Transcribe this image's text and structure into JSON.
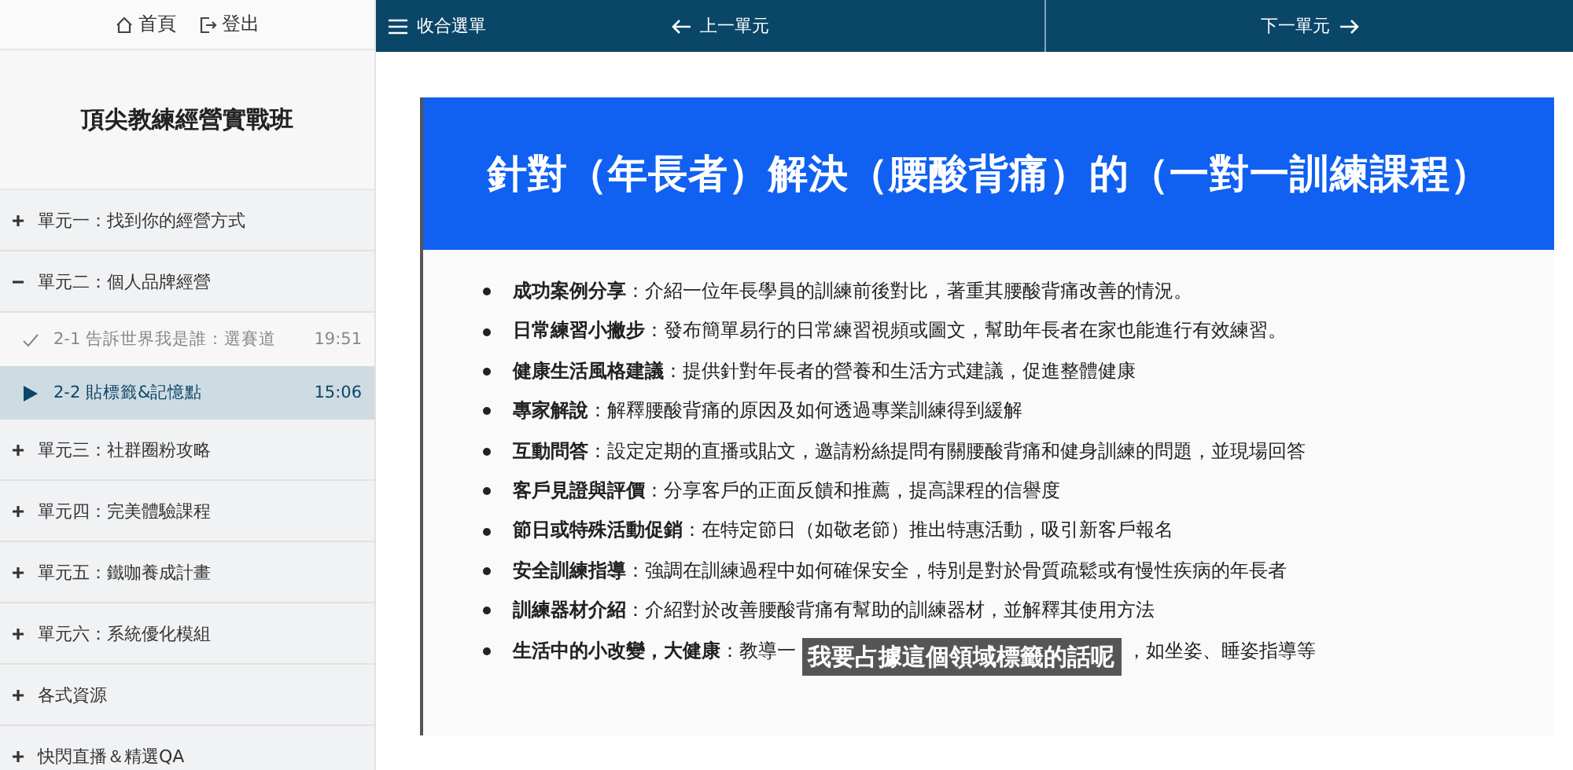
{
  "top_links": [
    {
      "kind": "home",
      "label": "首頁"
    },
    {
      "kind": "logout",
      "label": "登出"
    }
  ],
  "course_title": "頂尖教練經營實戰班",
  "sections": [
    {
      "label": "單元一：找到你的經營方式",
      "expanded": false
    },
    {
      "label": "單元二：個人品牌經營",
      "expanded": true,
      "lessons": [
        {
          "label": "2-1 告訴世界我是誰：選賽道",
          "duration": "19:51",
          "completed": true,
          "selected": false
        },
        {
          "label": "2-2 貼標籤&記憶點",
          "duration": "15:06",
          "completed": false,
          "selected": true
        }
      ]
    },
    {
      "label": "單元三：社群圈粉攻略",
      "expanded": false
    },
    {
      "label": "單元四：完美體驗課程",
      "expanded": false
    },
    {
      "label": "單元五：鐵咖養成計畫",
      "expanded": false
    },
    {
      "label": "單元六：系統優化模組",
      "expanded": false
    },
    {
      "label": "各式資源",
      "expanded": false
    },
    {
      "label": "快閃直播＆精選QA",
      "expanded": false
    }
  ],
  "nav": {
    "collapse": "收合選單",
    "prev": "上一單元",
    "next": "下一單元"
  },
  "slide": {
    "title": "針對（年長者）解決（腰酸背痛）的（一對一訓練課程）",
    "items": [
      {
        "term": "成功案例分享",
        "text": "：介紹一位年長學員的訓練前後對比，著重其腰酸背痛改善的情況。"
      },
      {
        "term": "日常練習小撇步",
        "text": "：發布簡單易行的日常練習視頻或圖文，幫助年長者在家也能進行有效練習。"
      },
      {
        "term": "健康生活風格建議",
        "text": "：提供針對年長者的營養和生活方式建議，促進整體健康"
      },
      {
        "term": "專家解說",
        "text": "：解釋腰酸背痛的原因及如何透過專業訓練得到緩解"
      },
      {
        "term": "互動問答",
        "text": "：設定定期的直播或貼文，邀請粉絲提問有關腰酸背痛和健身訓練的問題，並現場回答"
      },
      {
        "term": "客戶見證與評價",
        "text": "：分享客戶的正面反饋和推薦，提高課程的信譽度"
      },
      {
        "term": "節日或特殊活動促銷",
        "text": "：在特定節日（如敬老節）推出特惠活動，吸引新客戶報名"
      },
      {
        "term": "安全訓練指導",
        "text": "：強調在訓練過程中如何確保安全，特別是對於骨質疏鬆或有慢性疾病的年長者"
      },
      {
        "term": "訓練器材介紹",
        "text": "：介紹對於改善腰酸背痛有幫助的訓練器材，並解釋其使用方法"
      },
      {
        "term": "生活中的小改變，大健康",
        "text": "：教導一",
        "subtitle": "我要占據這個領域標籤的話呢",
        "text_end": "，如坐姿、睡姿指導等"
      }
    ]
  }
}
